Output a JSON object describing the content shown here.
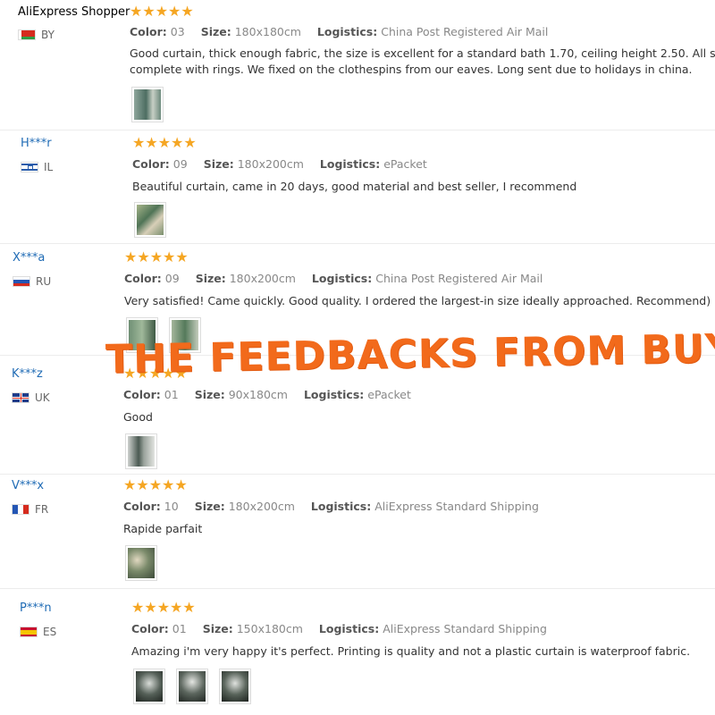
{
  "accent": "#f5a623",
  "watermark": "THE FEEDBACKS FROM BUYERS",
  "labels": {
    "color": "Color:",
    "size": "Size:",
    "logistics": "Logistics:"
  },
  "stars": "★★★★★",
  "reviews": [
    {
      "name": "AliExpress Shopper",
      "name_color": "#000000",
      "country": "BY",
      "flag": "by",
      "color": "03",
      "size": "180x180cm",
      "logistics": "China Post Registered Air Mail",
      "text": "Good curtain, thick enough fabric, the size is excellent for a standard bath 1.70, ceiling height 2.50. All stitche",
      "text2": "complete with rings. We fixed on the clothespins from our eaves. Long sent due to holidays in china.",
      "photos": 1
    },
    {
      "name": "H***r",
      "name_color": "#1f6bb5",
      "country": "IL",
      "flag": "il",
      "color": "09",
      "size": "180x200cm",
      "logistics": "ePacket",
      "text": "Beautiful curtain, came in 20 days, good material and best seller, I recommend",
      "photos": 1
    },
    {
      "name": "X***a",
      "name_color": "#1f6bb5",
      "country": "RU",
      "flag": "ru",
      "color": "09",
      "size": "180x200cm",
      "logistics": "China Post Registered Air Mail",
      "text": "Very satisfied! Came quickly. Good quality. I ordered the largest-in size ideally approached. Recommend)",
      "photos": 2
    },
    {
      "name": "K***z",
      "name_color": "#1f6bb5",
      "country": "UK",
      "flag": "uk",
      "color": "01",
      "size": "90x180cm",
      "logistics": "ePacket",
      "text": "Good",
      "photos": 1
    },
    {
      "name": "V***x",
      "name_color": "#1f6bb5",
      "country": "FR",
      "flag": "fr",
      "color": "10",
      "size": "180x200cm",
      "logistics": "AliExpress Standard Shipping",
      "text": "Rapide parfait",
      "photos": 1
    },
    {
      "name": "P***n",
      "name_color": "#1f6bb5",
      "country": "ES",
      "flag": "es",
      "color": "01",
      "size": "150x180cm",
      "logistics": "AliExpress Standard Shipping",
      "text": "Amazing i'm very happy it's perfect. Printing is quality and not a plastic curtain is waterproof fabric.",
      "photos": 3
    }
  ]
}
